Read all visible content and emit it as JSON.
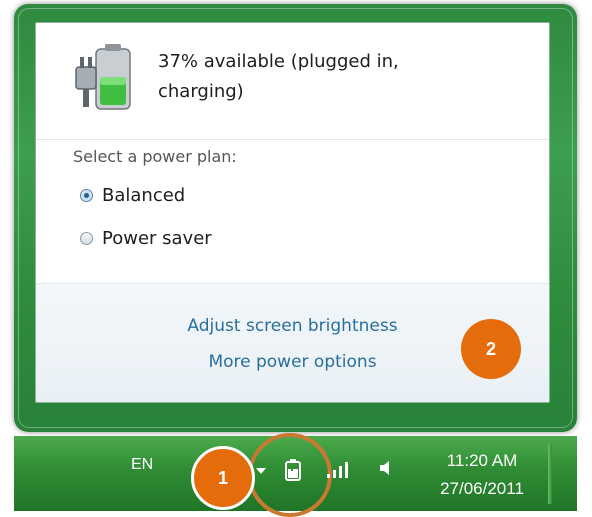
{
  "flyout": {
    "status_line1": "37% available (plugged in,",
    "status_line2": "charging)",
    "plan_title": "Select a power plan:",
    "plans": [
      {
        "label": "Balanced",
        "selected": true
      },
      {
        "label": "Power saver",
        "selected": false
      }
    ],
    "links": [
      "Adjust screen brightness",
      "More power options"
    ]
  },
  "taskbar": {
    "language": "EN",
    "time": "11:20 AM",
    "date": "27/06/2011"
  },
  "callouts": [
    "1",
    "2"
  ],
  "colors": {
    "frame_green": "#3c9f4d",
    "callout_orange": "#e46c0a",
    "link_blue": "#2a6f9b"
  },
  "icons": [
    "battery-plug-icon",
    "power-tray-icon",
    "signal-icon",
    "volume-icon",
    "tray-arrow-icon"
  ]
}
